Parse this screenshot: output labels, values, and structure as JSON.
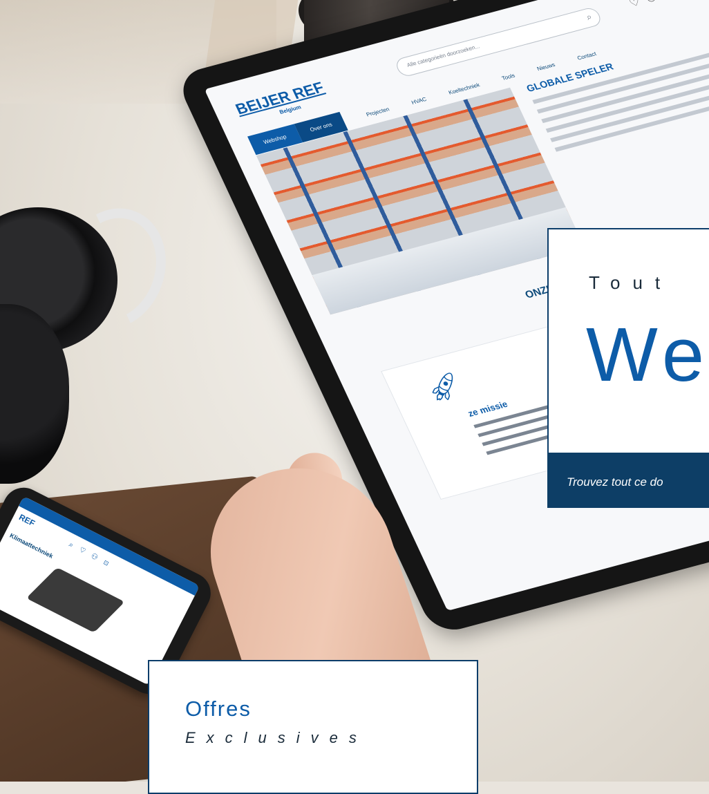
{
  "colors": {
    "brand_blue": "#0d5ca8",
    "navy": "#0d3e66",
    "white": "#ffffff"
  },
  "tablet": {
    "logo": "BEIJER REF",
    "logo_sub": "Belgium",
    "search_placeholder": "Alle categorieën doorzoeken...",
    "tabs": [
      "Webshop",
      "Over ons"
    ],
    "nav": [
      "Projecten",
      "HVAC",
      "Koeltechniek",
      "Tools",
      "Nieuws",
      "Contact"
    ],
    "heading": "GLOBALE SPELER",
    "section_title": "ONZE M",
    "mission_title": "ze missie",
    "header_icons": [
      "heart-icon",
      "user-icon"
    ]
  },
  "phone": {
    "logo": "REF",
    "category": "Klimaattechniek",
    "icons": [
      "search-icon",
      "heart-icon",
      "user-icon",
      "cart-icon"
    ]
  },
  "promo": {
    "eyebrow": "Tout",
    "title": "We",
    "tagline": "Trouvez tout ce do"
  },
  "offer": {
    "title": "Offres",
    "subtitle": "Exclusives"
  }
}
